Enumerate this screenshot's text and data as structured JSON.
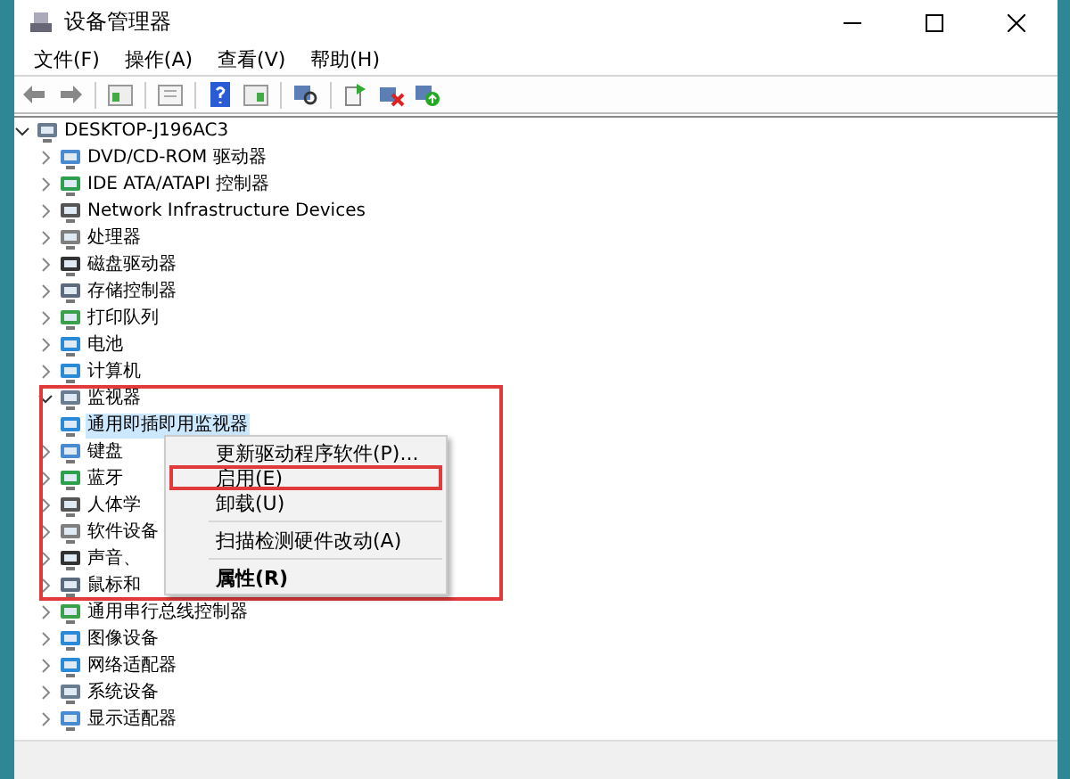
{
  "window": {
    "title": "设备管理器"
  },
  "menu_bar": [
    "文件(F)",
    "操作(A)",
    "查看(V)",
    "帮助(H)"
  ],
  "tree": {
    "label": "DESKTOP-J196AC3",
    "expanded": true,
    "children": [
      {
        "label": "DVD/CD-ROM 驱动器",
        "expanded": false
      },
      {
        "label": "IDE ATA/ATAPI 控制器",
        "expanded": false
      },
      {
        "label": "Network Infrastructure Devices",
        "expanded": false
      },
      {
        "label": "处理器",
        "expanded": false
      },
      {
        "label": "磁盘驱动器",
        "expanded": false
      },
      {
        "label": "存储控制器",
        "expanded": false
      },
      {
        "label": "打印队列",
        "expanded": false
      },
      {
        "label": "电池",
        "expanded": false
      },
      {
        "label": "计算机",
        "expanded": false
      },
      {
        "label": "监视器",
        "expanded": true,
        "highlighted": true,
        "children": [
          {
            "label": "通用即插即用监视器",
            "selected": true
          }
        ]
      },
      {
        "label": "键盘",
        "expanded": false
      },
      {
        "label": "蓝牙",
        "expanded": false
      },
      {
        "label": "人体学",
        "expanded": false
      },
      {
        "label": "软件设备",
        "expanded": false
      },
      {
        "label": "声音、",
        "expanded": false
      },
      {
        "label": "鼠标和",
        "expanded": false
      },
      {
        "label": "通用串行总线控制器",
        "expanded": false
      },
      {
        "label": "图像设备",
        "expanded": false
      },
      {
        "label": "网络适配器",
        "expanded": false
      },
      {
        "label": "系统设备",
        "expanded": false
      },
      {
        "label": "显示适配器",
        "expanded": false
      }
    ]
  },
  "context_menu": {
    "items": [
      {
        "kind": "item",
        "label": "更新驱动程序软件(P)...",
        "bold": false,
        "highlighted": false
      },
      {
        "kind": "item",
        "label": "启用(E)",
        "bold": false,
        "highlighted": true
      },
      {
        "kind": "item",
        "label": "卸载(U)",
        "bold": false,
        "highlighted": false
      },
      {
        "kind": "separator"
      },
      {
        "kind": "item",
        "label": "扫描检测硬件改动(A)",
        "bold": false,
        "highlighted": false
      },
      {
        "kind": "separator"
      },
      {
        "kind": "item",
        "label": "属性(R)",
        "bold": true,
        "highlighted": false
      }
    ]
  }
}
